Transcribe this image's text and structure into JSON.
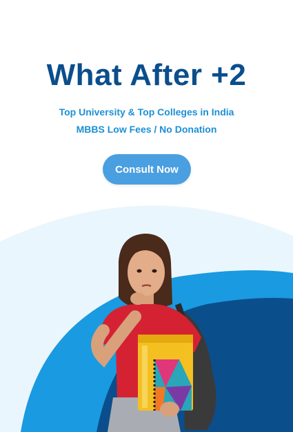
{
  "hero": {
    "title": "What After +2",
    "subtitle_line1": "Top University & Top Colleges in India",
    "subtitle_line2": "MBBS Low Fees / No Donation",
    "cta_label": "Consult Now"
  },
  "illustration": {
    "subject": "student-holding-books",
    "colors": {
      "title": "#0b4e8c",
      "subtitle": "#1c8fd6",
      "button": "#4a9fe0",
      "arc_light": "#eaf6fd",
      "arc_mid": "#1a9ae0",
      "arc_dark": "#0b4e8c"
    }
  }
}
